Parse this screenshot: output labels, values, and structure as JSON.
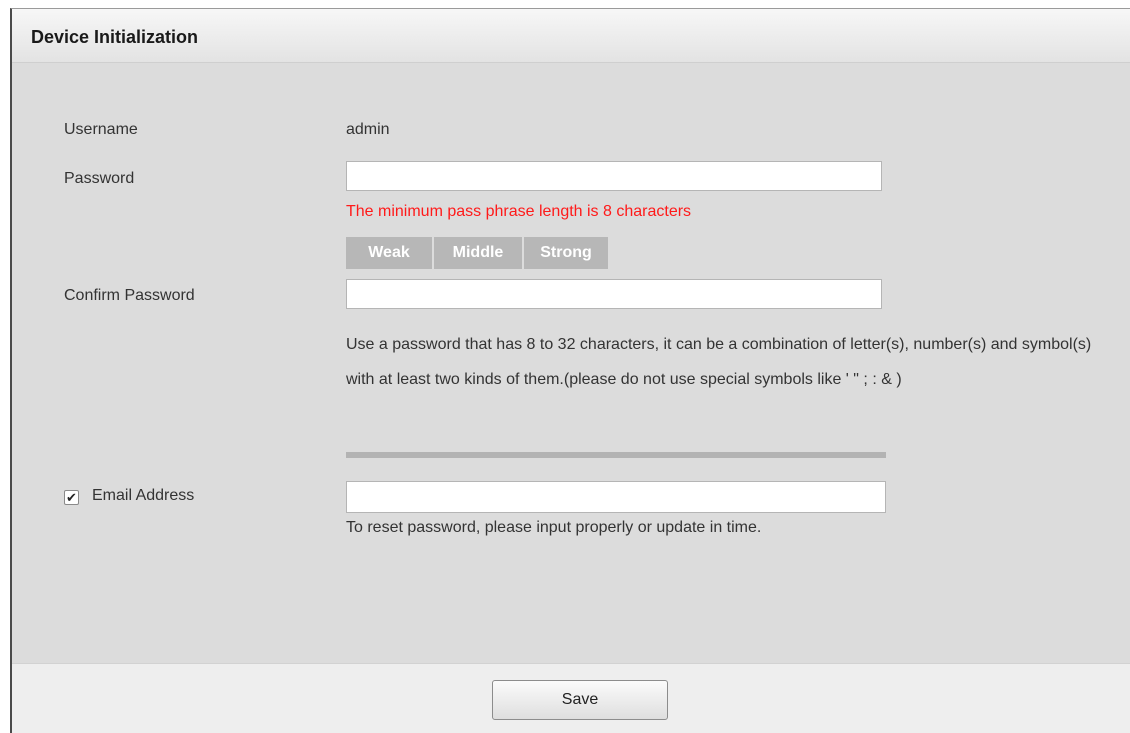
{
  "dialog": {
    "title": "Device Initialization"
  },
  "form": {
    "username_label": "Username",
    "username_value": "admin",
    "password_label": "Password",
    "password_value": "",
    "password_error": "The minimum pass phrase length is 8 characters",
    "strength_levels": [
      "Weak",
      "Middle",
      "Strong"
    ],
    "confirm_label": "Confirm Password",
    "confirm_value": "",
    "password_hint": "Use a password that has 8 to 32 characters, it can be a combination of letter(s), number(s) and symbol(s) with at least two kinds of them.(please do not use special symbols like ' \" ; : & )",
    "email_checked": true,
    "email_label": "Email Address",
    "email_value": "",
    "email_note": "To reset password, please input properly or update in time."
  },
  "footer": {
    "save_label": "Save"
  },
  "colors": {
    "error": "#ff1a1a",
    "strength_inactive": "#b7b7b7",
    "panel_bg": "#dcdcdc"
  }
}
